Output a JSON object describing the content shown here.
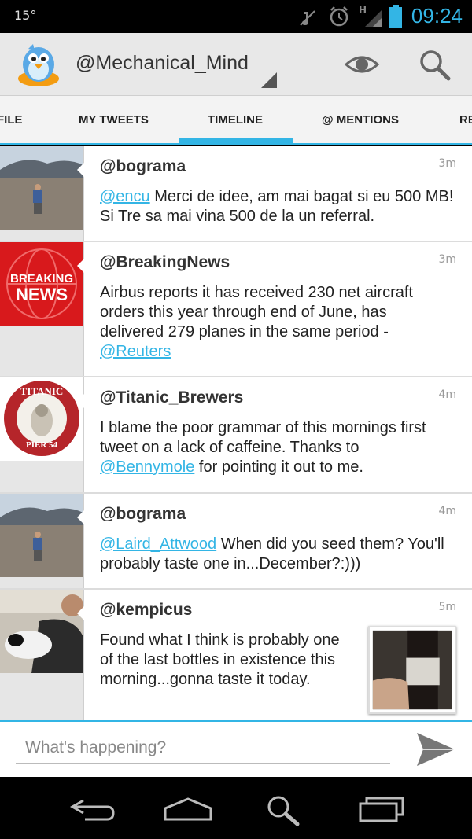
{
  "status_bar": {
    "temperature": "15°",
    "network": "H",
    "time": "09:24",
    "icons": [
      "mute-icon",
      "alarm-icon",
      "signal-icon",
      "battery-icon"
    ]
  },
  "action_bar": {
    "account": "@Mechanical_Mind",
    "icons": [
      "app-logo-icon",
      "eye-icon",
      "search-icon"
    ]
  },
  "tabs": [
    {
      "label": "FILE"
    },
    {
      "label": "MY TWEETS"
    },
    {
      "label": "TIMELINE",
      "active": true
    },
    {
      "label": "@ MENTIONS"
    },
    {
      "label": "RE"
    }
  ],
  "tweets": [
    {
      "user": "@bograma",
      "time": "3m",
      "mention": "@encu",
      "text": " Merci de idee, am mai bagat si eu 500 MB! Si Tre sa mai vina 500 de la un referral."
    },
    {
      "user": "@BreakingNews",
      "time": "3m",
      "text": "Airbus reports it has received 230 net aircraft orders this year through end of June, has delivered 279 planes in the same period - ",
      "mention": "@Reuters",
      "avatar_text": [
        "BREAKING",
        "NEWS"
      ]
    },
    {
      "user": "@Titanic_Brewers",
      "time": "4m",
      "text": "I blame the poor grammar of this mornings first tweet on a lack of caffeine. Thanks to ",
      "mention": "@Bennymole",
      "text2": " for pointing it out to me.",
      "avatar_text": [
        "TITANIC",
        "PIER 54"
      ]
    },
    {
      "user": "@bograma",
      "time": "4m",
      "mention": "@Laird_Attwood",
      "text": " When did you seed them? You'll probably taste one in...December?:)))"
    },
    {
      "user": "@kempicus",
      "time": "5m",
      "text": "Found what I think is probably one of the last bottles in existence this morning...gonna taste it today."
    }
  ],
  "compose": {
    "placeholder": "What's happening?"
  },
  "nav_bar": {
    "icons": [
      "back-icon",
      "home-icon",
      "search-icon",
      "recents-icon"
    ]
  },
  "colors": {
    "accent": "#33b5e5",
    "breaking_red": "#d8191c",
    "titanic_red": "#b5252a"
  }
}
